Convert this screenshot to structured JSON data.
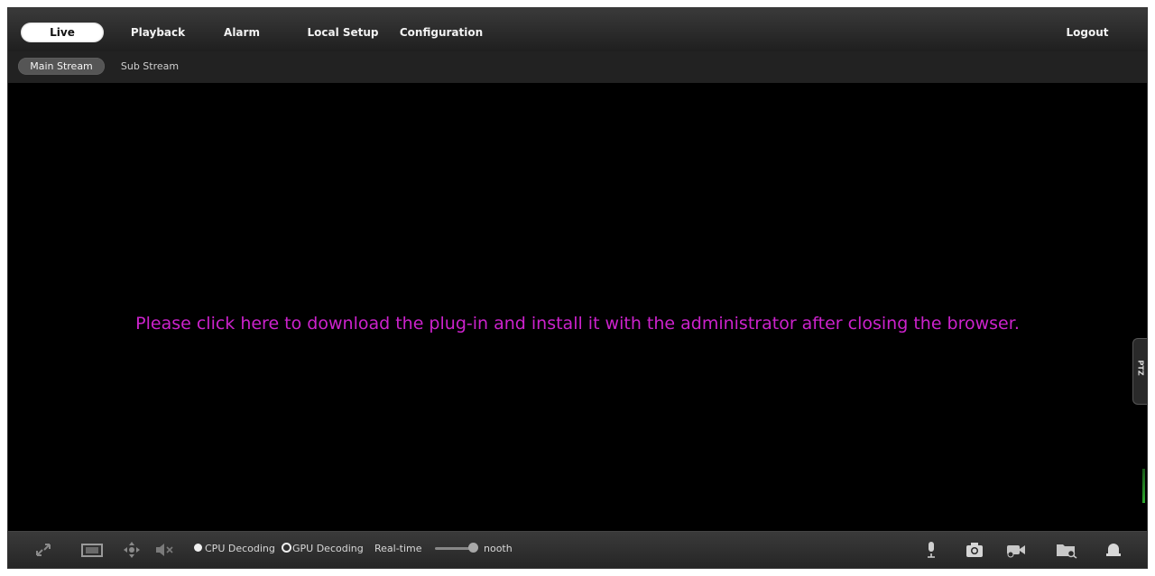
{
  "topnav": {
    "items": [
      {
        "label": "Live",
        "active": true
      },
      {
        "label": "Playback"
      },
      {
        "label": "Alarm"
      },
      {
        "label": "Local Setup"
      },
      {
        "label": "Configuration"
      }
    ],
    "logout_label": "Logout"
  },
  "subnav": {
    "items": [
      {
        "label": "Main Stream",
        "active": true
      },
      {
        "label": "Sub Stream"
      }
    ]
  },
  "video": {
    "plugin_message": "Please click here to download the plug-in and install it with the administrator after closing the browser.",
    "message_color": "#cc22cc",
    "ptz_label": "PTZ"
  },
  "toolbar": {
    "left_icons": [
      "fullscreen-icon",
      "aspect-ratio-icon",
      "ptz-control-icon",
      "mute-icon"
    ],
    "decoding": {
      "cpu_label": "CPU Decoding",
      "gpu_label": "GPU Decoding",
      "selected": "CPU Decoding"
    },
    "latency": {
      "left_label": "Real-time",
      "right_label": "nooth",
      "level": 1.0
    },
    "right_icons": [
      "microphone-icon",
      "snapshot-icon",
      "record-icon",
      "search-folder-icon",
      "alarm-bell-icon"
    ]
  }
}
